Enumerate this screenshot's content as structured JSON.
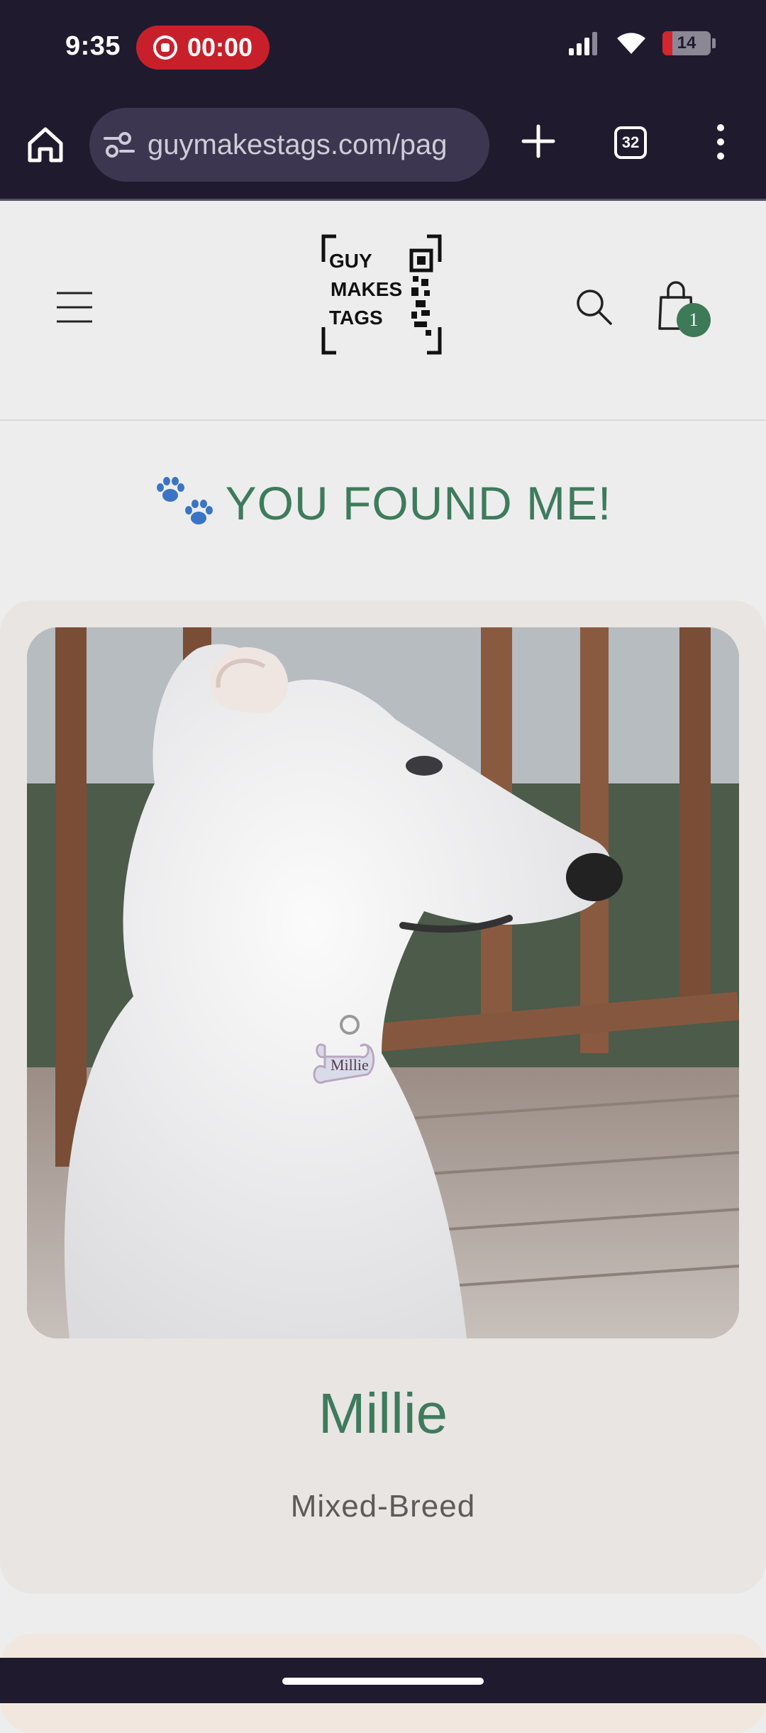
{
  "status_bar": {
    "time": "9:35",
    "recording_time": "00:00",
    "battery_level": "14",
    "icons": [
      "record-icon",
      "signal-icon",
      "wifi-icon",
      "battery-icon"
    ]
  },
  "browser": {
    "url": "guymakestags.com/pag",
    "tab_count": "32",
    "icons": [
      "home-icon",
      "site-settings-icon",
      "new-tab-icon",
      "tabs-icon",
      "more-menu-icon"
    ]
  },
  "site_header": {
    "logo_text": [
      "GUY",
      "MAKES",
      "TAGS"
    ],
    "cart_count": "1",
    "icons": [
      "hamburger-menu-icon",
      "search-icon",
      "shopping-bag-icon"
    ]
  },
  "page": {
    "heading": "YOU FOUND ME!",
    "heading_icon": "paw-prints-icon",
    "accent_color": "#3e7b5c"
  },
  "pet": {
    "name": "Millie",
    "breed": "Mixed-Breed",
    "tag_text": "Millie",
    "photo": "white-dog-photo"
  }
}
